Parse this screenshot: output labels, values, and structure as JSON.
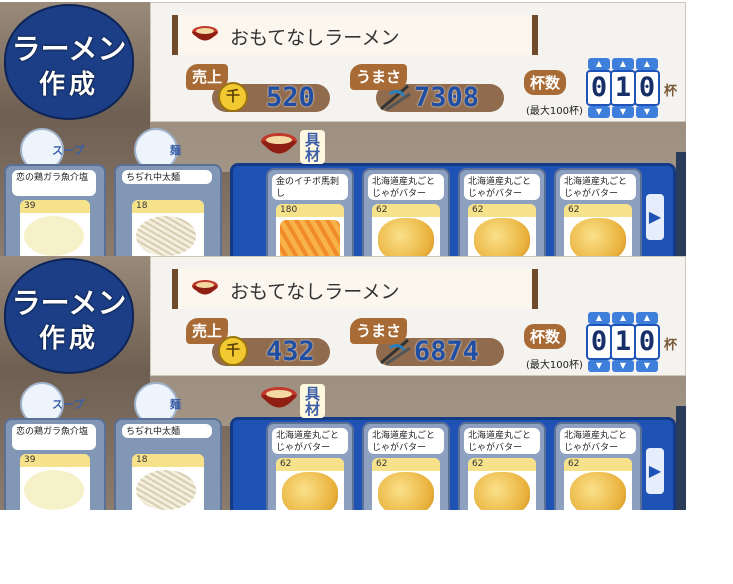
{
  "panels": [
    {
      "badge": {
        "line1": "ラーメン",
        "line2": "作成"
      },
      "recipe_name": "おもてなしラーメン",
      "sales": {
        "label": "売上",
        "coin_glyph": "千",
        "value": "520"
      },
      "taste": {
        "label": "うまさ",
        "value": "7308"
      },
      "cups": {
        "label": "杯数",
        "digits": [
          "0",
          "1",
          "0"
        ],
        "unit": "杯",
        "max": "(最大100杯)"
      },
      "categories": {
        "soup_label": "スープ",
        "noodle_label": "麺",
        "topping_label": "具材"
      },
      "soup_card": {
        "name": "恋の鶏ガラ魚介塩",
        "score": "39"
      },
      "noodle_card": {
        "name": "ちぢれ中太麺",
        "score": "18"
      },
      "toppings": [
        {
          "name": "金のイチボ馬刺し",
          "score": "180",
          "food": "fried"
        },
        {
          "name": "北海道産丸ごとじゃがバター",
          "score": "62",
          "food": "potato"
        },
        {
          "name": "北海道産丸ごとじゃがバター",
          "score": "62",
          "food": "potato"
        },
        {
          "name": "北海道産丸ごとじゃがバター",
          "score": "62",
          "food": "potato"
        }
      ],
      "next_arrow": "▶"
    },
    {
      "badge": {
        "line1": "ラーメン",
        "line2": "作成"
      },
      "recipe_name": "おもてなしラーメン",
      "sales": {
        "label": "売上",
        "coin_glyph": "千",
        "value": "432"
      },
      "taste": {
        "label": "うまさ",
        "value": "6874"
      },
      "cups": {
        "label": "杯数",
        "digits": [
          "0",
          "1",
          "0"
        ],
        "unit": "杯",
        "max": "(最大100杯)"
      },
      "categories": {
        "soup_label": "スープ",
        "noodle_label": "麺",
        "topping_label": "具材"
      },
      "soup_card": {
        "name": "恋の鶏ガラ魚介塩",
        "score": "39"
      },
      "noodle_card": {
        "name": "ちぢれ中太麺",
        "score": "18"
      },
      "toppings": [
        {
          "name": "北海道産丸ごとじゃがバター",
          "score": "62",
          "food": "potato"
        },
        {
          "name": "北海道産丸ごとじゃがバター",
          "score": "62",
          "food": "potato"
        },
        {
          "name": "北海道産丸ごとじゃがバター",
          "score": "62",
          "food": "potato"
        },
        {
          "name": "北海道産丸ごとじゃがバター",
          "score": "62",
          "food": "potato"
        }
      ],
      "next_arrow": "▶"
    }
  ],
  "colors": {
    "badge_blue": "#1b3e86",
    "score_blue": "#1f4ea3",
    "topping_frame": "#1f52b5"
  }
}
